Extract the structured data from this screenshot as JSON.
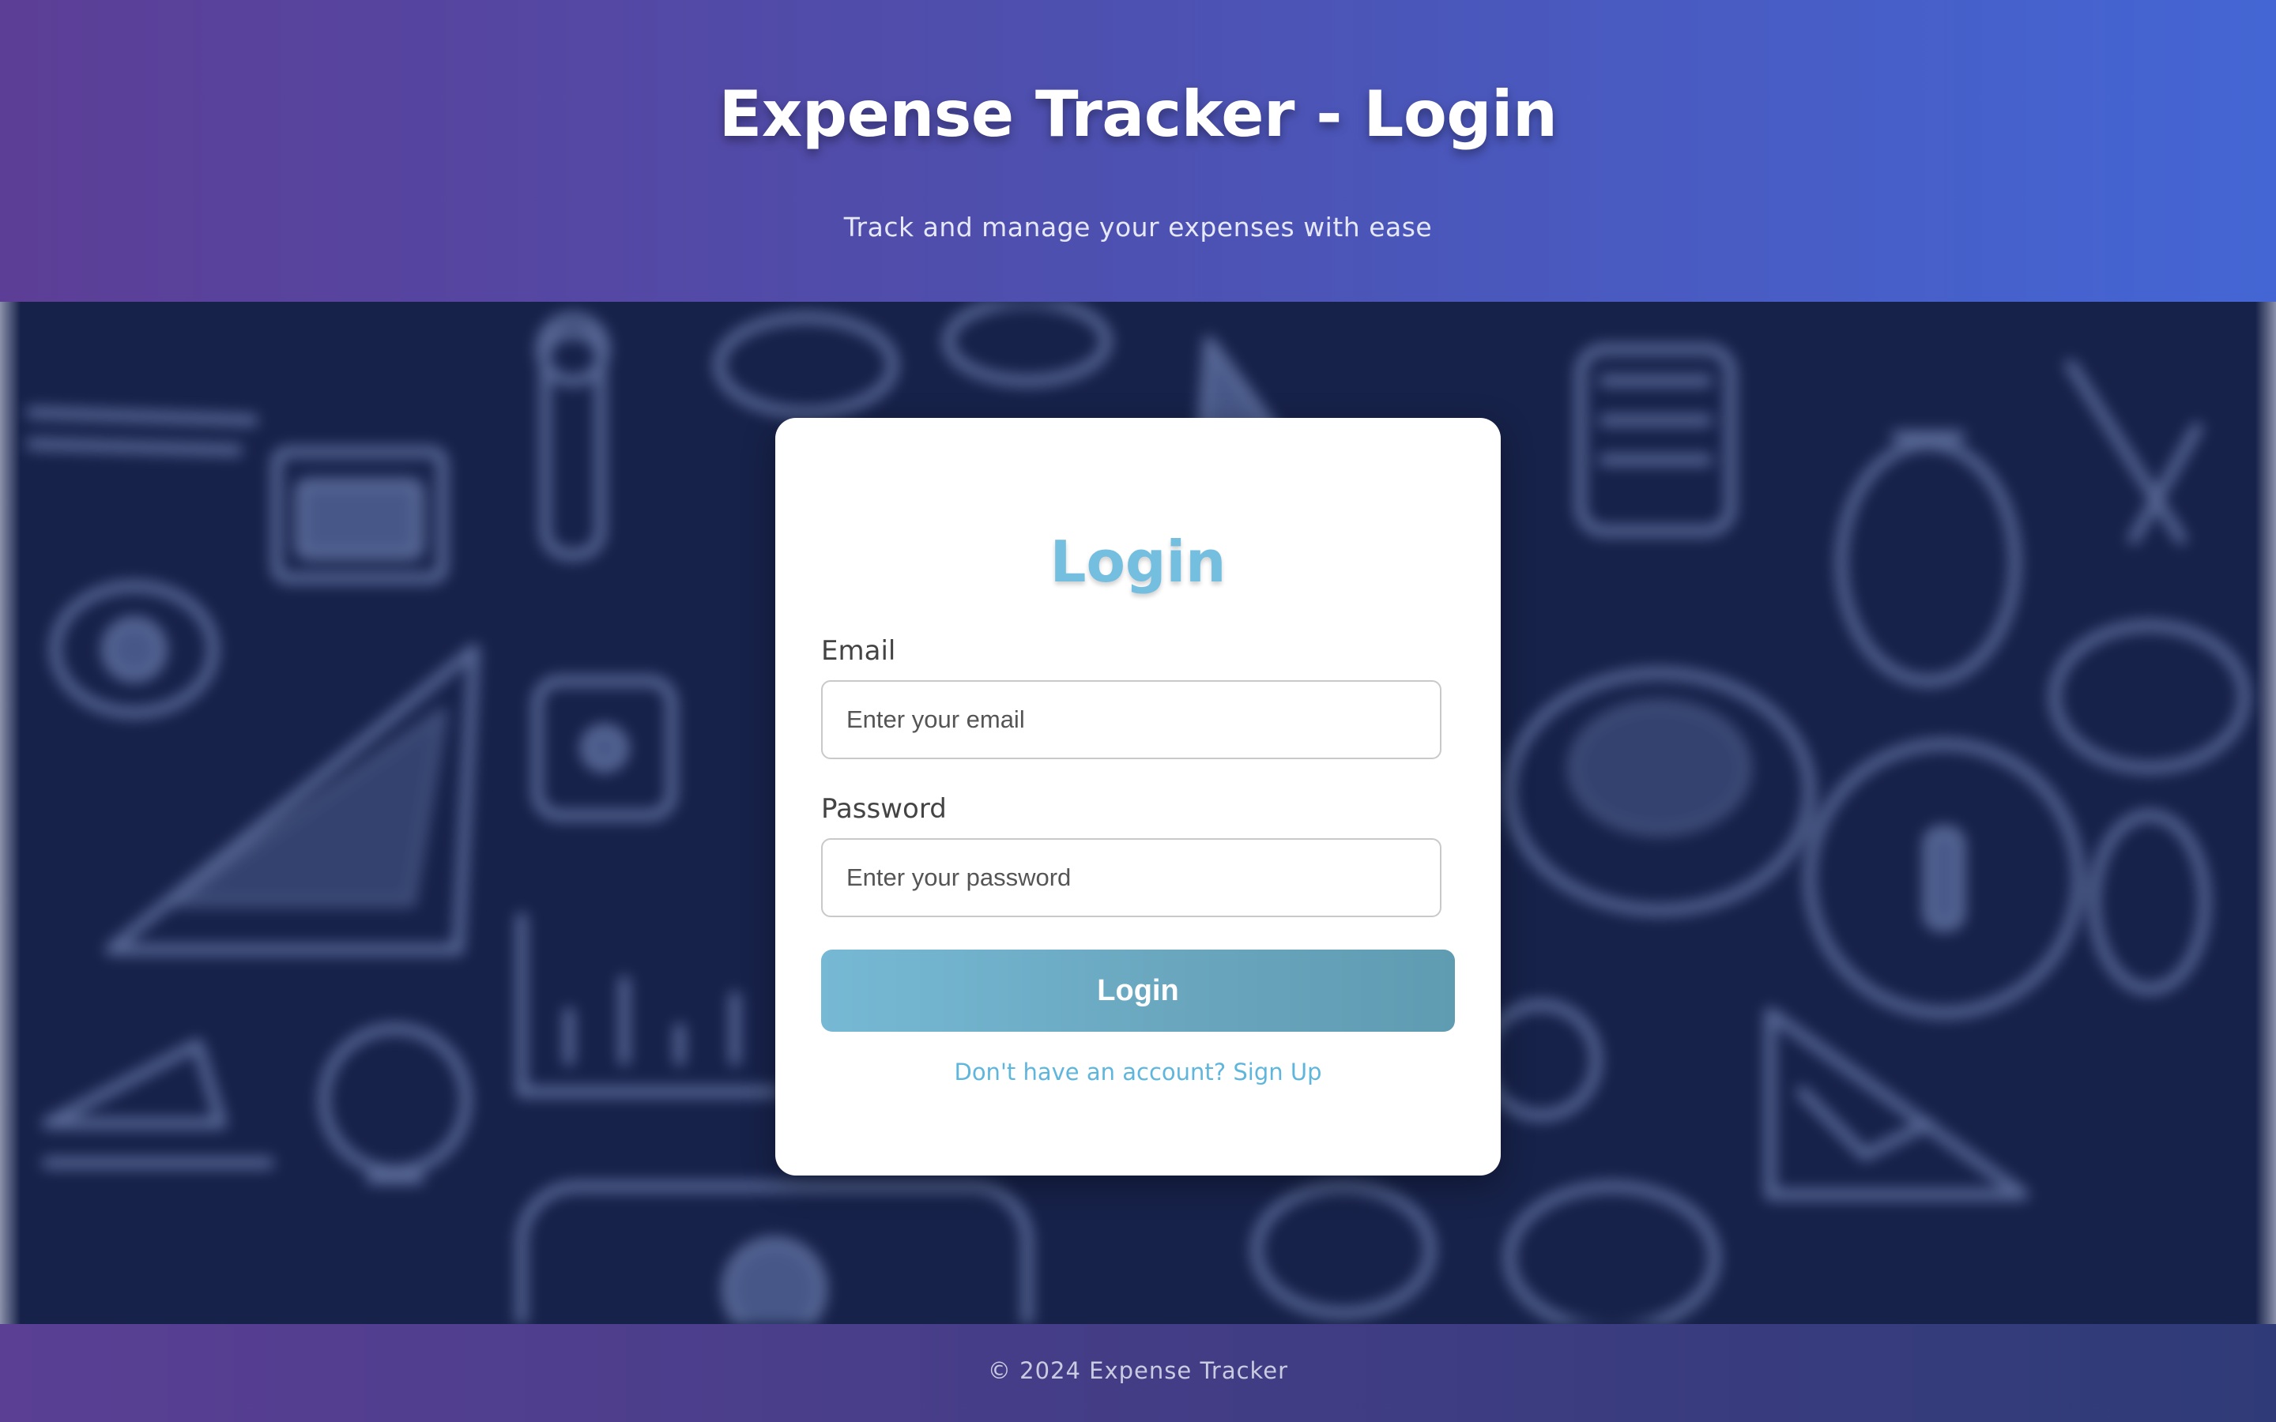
{
  "header": {
    "title": "Expense Tracker - Login",
    "subtitle": "Track and manage your expenses with ease"
  },
  "login_form": {
    "title": "Login",
    "email": {
      "label": "Email",
      "placeholder": "Enter your email",
      "value": ""
    },
    "password": {
      "label": "Password",
      "placeholder": "Enter your password",
      "value": ""
    },
    "submit_label": "Login",
    "signup_link": "Don't have an account? Sign Up"
  },
  "footer": {
    "text": "© 2024 Expense Tracker"
  },
  "colors": {
    "header_gradient_start": "#5c3e96",
    "header_gradient_end": "#4466d4",
    "background": "#17224a",
    "accent": "#74bedf",
    "button_gradient_start": "#76b9d4",
    "button_gradient_end": "#5f9bb1",
    "footer_gradient_start": "#5a3f94",
    "footer_gradient_end": "#2f3b78"
  },
  "background_icons": [
    "pie-chart-icon",
    "money-stack-icon",
    "coin-icon",
    "bar-chart-icon",
    "piggy-bank-icon",
    "money-bag-icon",
    "calculator-icon",
    "receipt-icon"
  ]
}
